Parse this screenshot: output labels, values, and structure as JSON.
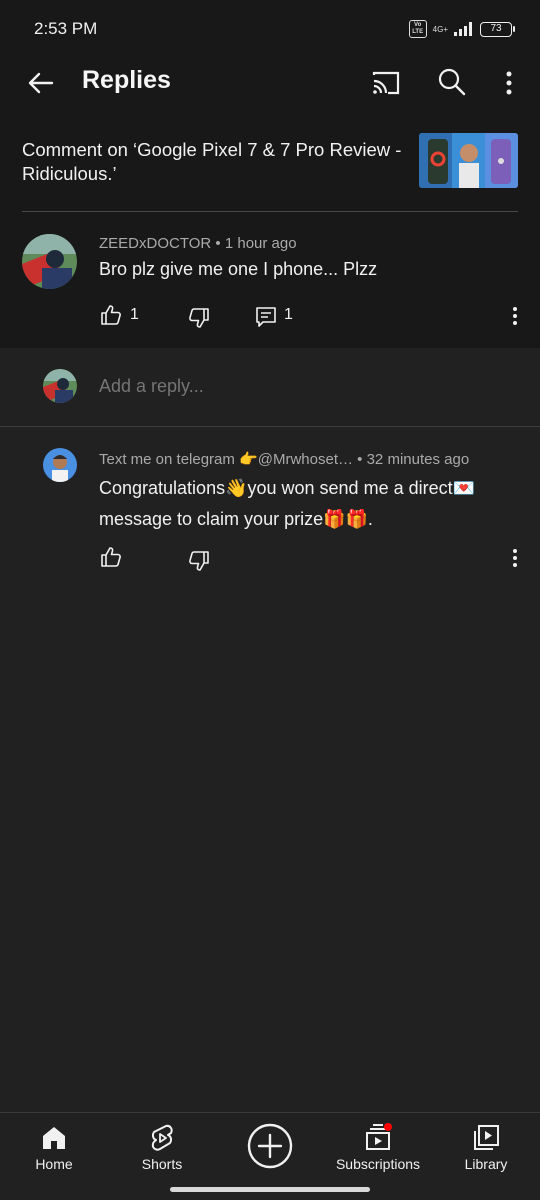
{
  "status_bar": {
    "time": "2:53 PM",
    "volte": "Vo LTE",
    "network": "4G+",
    "battery": "73"
  },
  "appbar": {
    "title": "Replies",
    "icons": [
      "back-arrow-icon",
      "cast-icon",
      "search-icon",
      "more-vertical-icon"
    ]
  },
  "context": {
    "text": "Comment on ‘Google Pixel 7 & 7 Pro Review - Ridiculous.’"
  },
  "parent_comment": {
    "author": "ZEEDxDOCTOR",
    "separator": "•",
    "time": "1 hour ago",
    "text": "Bro plz give me one I phone... Plzz",
    "likes": "1",
    "replies": "1"
  },
  "reply_box": {
    "placeholder": "Add a reply..."
  },
  "reply": {
    "author": "Text me on telegram 👉@Mrwhoset…",
    "separator": "•",
    "time": "32 minutes ago",
    "text": "Congratulations👋you won send me a direct💌 message to claim your prize🎁🎁."
  },
  "bottom_nav": {
    "items": [
      {
        "label": "Home",
        "icon": "home-icon"
      },
      {
        "label": "Shorts",
        "icon": "shorts-icon"
      },
      {
        "label": "Subscriptions",
        "icon": "subscriptions-icon"
      },
      {
        "label": "Library",
        "icon": "library-icon"
      }
    ],
    "create_icon": "add-circle-icon"
  },
  "colors": {
    "background": "#212121",
    "header": "#181818",
    "secondary_text": "#aaaaaa",
    "notification_dot": "#ff0000"
  }
}
